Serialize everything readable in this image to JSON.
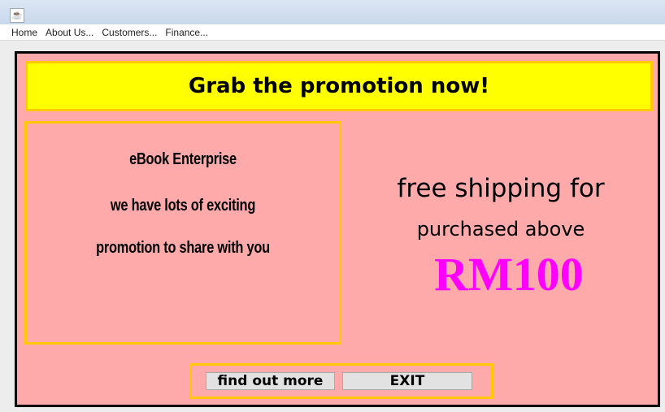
{
  "window": {
    "icon": "java-app-icon"
  },
  "menu": {
    "items": [
      "Home",
      "About Us...",
      "Customers...",
      "Finance..."
    ]
  },
  "banner": {
    "text": "Grab the promotion now!"
  },
  "info": {
    "lines": [
      "eBook Enterprise",
      "we have lots of exciting",
      "promotion to share with you"
    ]
  },
  "promo": {
    "line1": "free shipping for",
    "line2": "purchased above",
    "amount": "RM100",
    "amount_color": "#ff00ff"
  },
  "buttons": {
    "find_out_more": "find out more",
    "exit": "EXIT"
  },
  "colors": {
    "panel_background": "#ffaaaa",
    "banner_background": "#ffff00",
    "border_accent": "#ffc800",
    "panel_border": "#000000"
  }
}
